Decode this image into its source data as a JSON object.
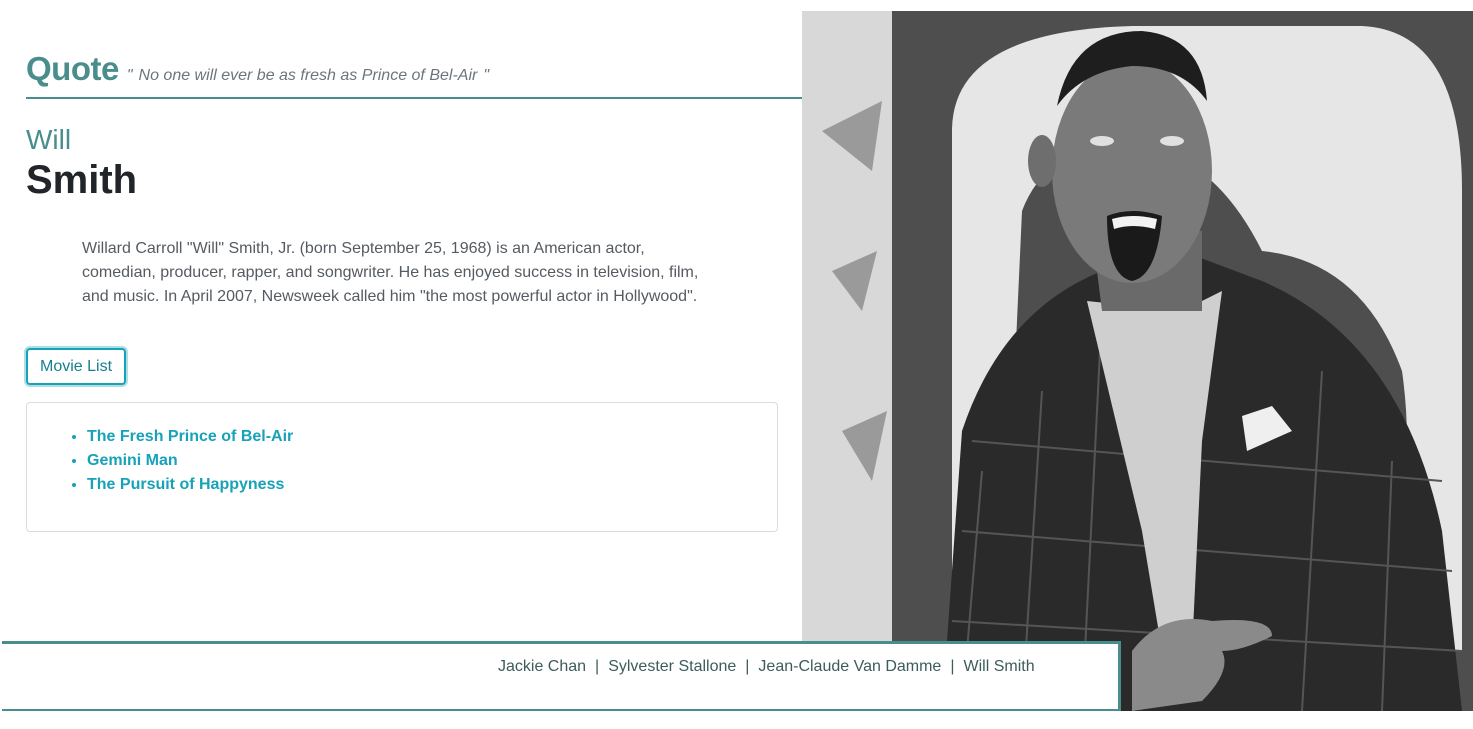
{
  "quote": {
    "heading": "Quote",
    "open_mark": "\"",
    "text": "No one will ever be as fresh as Prince of Bel-Air",
    "close_mark": "\""
  },
  "person": {
    "first_name": "Will",
    "last_name": "Smith",
    "bio": "Willard Carroll \"Will\" Smith, Jr. (born September 25, 1968) is an American actor, comedian, producer, rapper, and songwriter. He has enjoyed success in television, film, and music. In April 2007, Newsweek called him \"the most powerful actor in Hollywood\".",
    "photo_icon": "person-photo"
  },
  "movie_button": {
    "label": "Movie List"
  },
  "movies": [
    "The Fresh Prince of Bel-Air",
    "Gemini Man",
    "The Pursuit of Happyness"
  ],
  "footer": {
    "links": [
      "Jackie Chan",
      "Sylvester Stallone",
      "Jean-Claude Van Damme",
      "Will Smith"
    ],
    "separator": "|"
  },
  "colors": {
    "accent": "#4a8d8d",
    "link": "#17a2b8"
  }
}
